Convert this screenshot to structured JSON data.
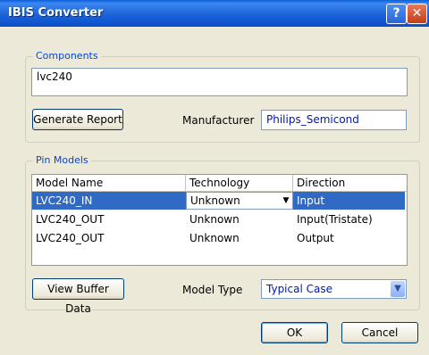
{
  "window": {
    "title": "IBIS Converter",
    "help_glyph": "?",
    "close_glyph": "✕"
  },
  "components": {
    "legend": "Components",
    "value": "lvc240",
    "generate_label": "Generate Report",
    "manufacturer_label": "Manufacturer",
    "manufacturer_value": "Philips_Semicond"
  },
  "pin_models": {
    "legend": "Pin Models",
    "columns": [
      "Model Name",
      "Technology",
      "Direction"
    ],
    "rows": [
      {
        "model": "LVC240_IN",
        "technology": "Unknown",
        "direction": "Input"
      },
      {
        "model": "LVC240_OUT",
        "technology": "Unknown",
        "direction": "Input(Tristate)"
      },
      {
        "model": "LVC240_OUT",
        "technology": "Unknown",
        "direction": "Output"
      }
    ],
    "view_buffer_label": "View Buffer Data",
    "model_type_label": "Model Type",
    "model_type_value": "Typical Case"
  },
  "footer": {
    "ok_label": "OK",
    "cancel_label": "Cancel"
  },
  "colors": {
    "accent": "#316ac5",
    "titlebar": "#0a4fc8",
    "legend": "#0046d5"
  }
}
